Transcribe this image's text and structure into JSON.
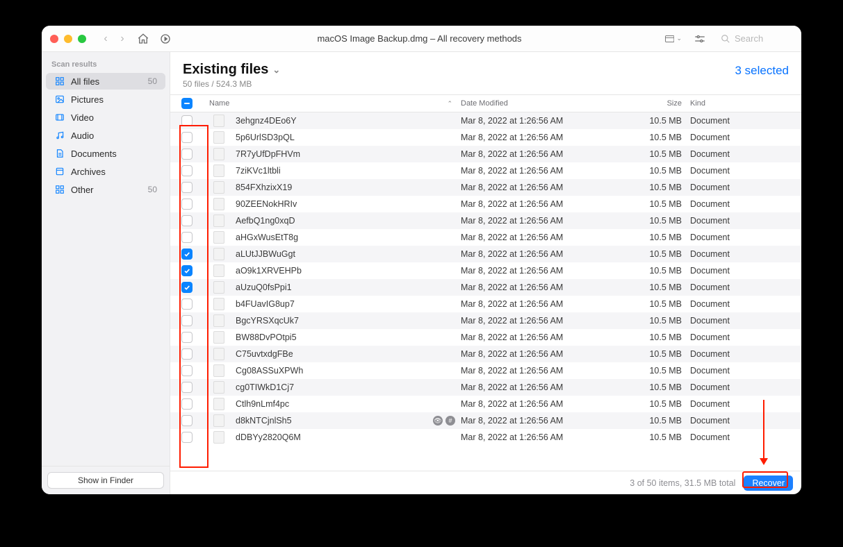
{
  "toolbar": {
    "title": "macOS Image Backup.dmg – All recovery methods",
    "search_placeholder": "Search"
  },
  "sidebar": {
    "section_label": "Scan results",
    "items": [
      {
        "label": "All files",
        "count": "50",
        "icon": "grid",
        "active": true
      },
      {
        "label": "Pictures",
        "count": "",
        "icon": "picture",
        "active": false
      },
      {
        "label": "Video",
        "count": "",
        "icon": "video",
        "active": false
      },
      {
        "label": "Audio",
        "count": "",
        "icon": "music",
        "active": false
      },
      {
        "label": "Documents",
        "count": "",
        "icon": "doc",
        "active": false
      },
      {
        "label": "Archives",
        "count": "",
        "icon": "archive",
        "active": false
      },
      {
        "label": "Other",
        "count": "50",
        "icon": "grid",
        "active": false
      }
    ],
    "finder_button": "Show in Finder"
  },
  "main": {
    "title": "Existing files",
    "subcount": "50 files / 524.3 MB",
    "selected_label": "3 selected"
  },
  "columns": {
    "name": "Name",
    "date": "Date Modified",
    "size": "Size",
    "kind": "Kind"
  },
  "files": [
    {
      "name": "3ehgnz4DEo6Y",
      "date": "Mar 8, 2022 at 1:26:56 AM",
      "size": "10.5 MB",
      "kind": "Document",
      "checked": false,
      "tagged": false
    },
    {
      "name": "5p6UrlSD3pQL",
      "date": "Mar 8, 2022 at 1:26:56 AM",
      "size": "10.5 MB",
      "kind": "Document",
      "checked": false,
      "tagged": false
    },
    {
      "name": "7R7yUfDpFHVm",
      "date": "Mar 8, 2022 at 1:26:56 AM",
      "size": "10.5 MB",
      "kind": "Document",
      "checked": false,
      "tagged": false
    },
    {
      "name": "7ziKVc1ltbli",
      "date": "Mar 8, 2022 at 1:26:56 AM",
      "size": "10.5 MB",
      "kind": "Document",
      "checked": false,
      "tagged": false
    },
    {
      "name": "854FXhzixX19",
      "date": "Mar 8, 2022 at 1:26:56 AM",
      "size": "10.5 MB",
      "kind": "Document",
      "checked": false,
      "tagged": false
    },
    {
      "name": "90ZEENokHRIv",
      "date": "Mar 8, 2022 at 1:26:56 AM",
      "size": "10.5 MB",
      "kind": "Document",
      "checked": false,
      "tagged": false
    },
    {
      "name": "AefbQ1ng0xqD",
      "date": "Mar 8, 2022 at 1:26:56 AM",
      "size": "10.5 MB",
      "kind": "Document",
      "checked": false,
      "tagged": false
    },
    {
      "name": "aHGxWusEtT8g",
      "date": "Mar 8, 2022 at 1:26:56 AM",
      "size": "10.5 MB",
      "kind": "Document",
      "checked": false,
      "tagged": false
    },
    {
      "name": "aLUtJJBWuGgt",
      "date": "Mar 8, 2022 at 1:26:56 AM",
      "size": "10.5 MB",
      "kind": "Document",
      "checked": true,
      "tagged": false
    },
    {
      "name": "aO9k1XRVEHPb",
      "date": "Mar 8, 2022 at 1:26:56 AM",
      "size": "10.5 MB",
      "kind": "Document",
      "checked": true,
      "tagged": false
    },
    {
      "name": "aUzuQ0fsPpi1",
      "date": "Mar 8, 2022 at 1:26:56 AM",
      "size": "10.5 MB",
      "kind": "Document",
      "checked": true,
      "tagged": false
    },
    {
      "name": "b4FUavIG8up7",
      "date": "Mar 8, 2022 at 1:26:56 AM",
      "size": "10.5 MB",
      "kind": "Document",
      "checked": false,
      "tagged": false
    },
    {
      "name": "BgcYRSXqcUk7",
      "date": "Mar 8, 2022 at 1:26:56 AM",
      "size": "10.5 MB",
      "kind": "Document",
      "checked": false,
      "tagged": false
    },
    {
      "name": "BW88DvPOtpi5",
      "date": "Mar 8, 2022 at 1:26:56 AM",
      "size": "10.5 MB",
      "kind": "Document",
      "checked": false,
      "tagged": false
    },
    {
      "name": "C75uvtxdgFBe",
      "date": "Mar 8, 2022 at 1:26:56 AM",
      "size": "10.5 MB",
      "kind": "Document",
      "checked": false,
      "tagged": false
    },
    {
      "name": "Cg08ASSuXPWh",
      "date": "Mar 8, 2022 at 1:26:56 AM",
      "size": "10.5 MB",
      "kind": "Document",
      "checked": false,
      "tagged": false
    },
    {
      "name": "cg0TIWkD1Cj7",
      "date": "Mar 8, 2022 at 1:26:56 AM",
      "size": "10.5 MB",
      "kind": "Document",
      "checked": false,
      "tagged": false
    },
    {
      "name": "Ctlh9nLmf4pc",
      "date": "Mar 8, 2022 at 1:26:56 AM",
      "size": "10.5 MB",
      "kind": "Document",
      "checked": false,
      "tagged": false
    },
    {
      "name": "d8kNTCjnlSh5",
      "date": "Mar 8, 2022 at 1:26:56 AM",
      "size": "10.5 MB",
      "kind": "Document",
      "checked": false,
      "tagged": true
    },
    {
      "name": "dDBYy2820Q6M",
      "date": "Mar 8, 2022 at 1:26:56 AM",
      "size": "10.5 MB",
      "kind": "Document",
      "checked": false,
      "tagged": false
    }
  ],
  "footer": {
    "status": "3 of 50 items, 31.5 MB total",
    "recover": "Recover"
  }
}
